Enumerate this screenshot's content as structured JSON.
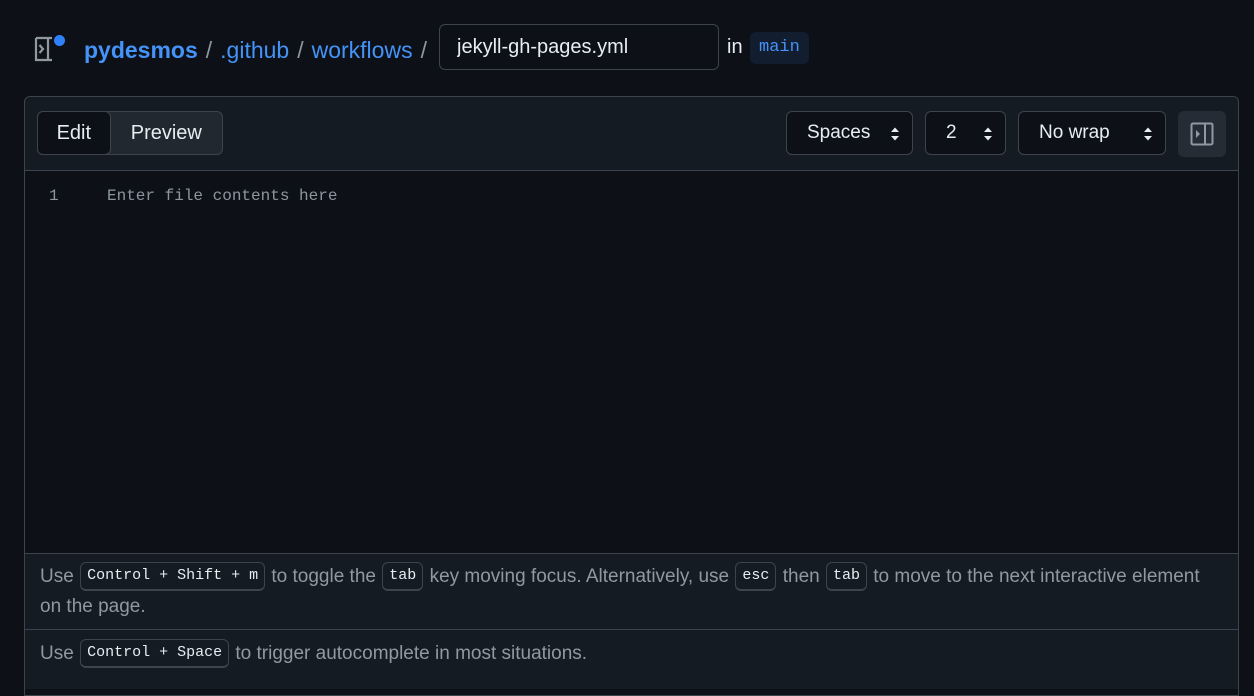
{
  "header": {
    "breadcrumb": {
      "repo": "pydesmos",
      "sep1": "/",
      "folder1": ".github",
      "sep2": "/",
      "folder2": "workflows",
      "sep3": "/"
    },
    "filename_value": "jekyll-gh-pages.yml",
    "in_label": "in",
    "branch": "main"
  },
  "toolbar": {
    "tabs": [
      {
        "label": "Edit",
        "active": true
      },
      {
        "label": "Preview",
        "active": false
      }
    ],
    "indent_mode": "Spaces",
    "indent_size": "2",
    "wrap_mode": "No wrap"
  },
  "editor": {
    "line_number": "1",
    "placeholder": "Enter file contents here"
  },
  "help": {
    "line1": {
      "t1": "Use",
      "k1": "Control + Shift + m",
      "t2": "to toggle the",
      "k2": "tab",
      "t3": "key moving focus. Alternatively, use",
      "k3": "esc",
      "t4": "then",
      "k4": "tab",
      "t5": "to move to the next interactive element on the page."
    },
    "line2": {
      "t1": "Use",
      "k1": "Control + Space",
      "t2": "to trigger autocomplete in most situations."
    }
  },
  "colors": {
    "accent": "#4493f8",
    "background": "#0d1117",
    "notification_dot": "#2f81f7"
  },
  "icons": {
    "file_tree_toggle": "sidebar-expand-icon",
    "select_arrows": "up-down-chevron-icon",
    "panel_toggle": "split-panel-icon"
  }
}
